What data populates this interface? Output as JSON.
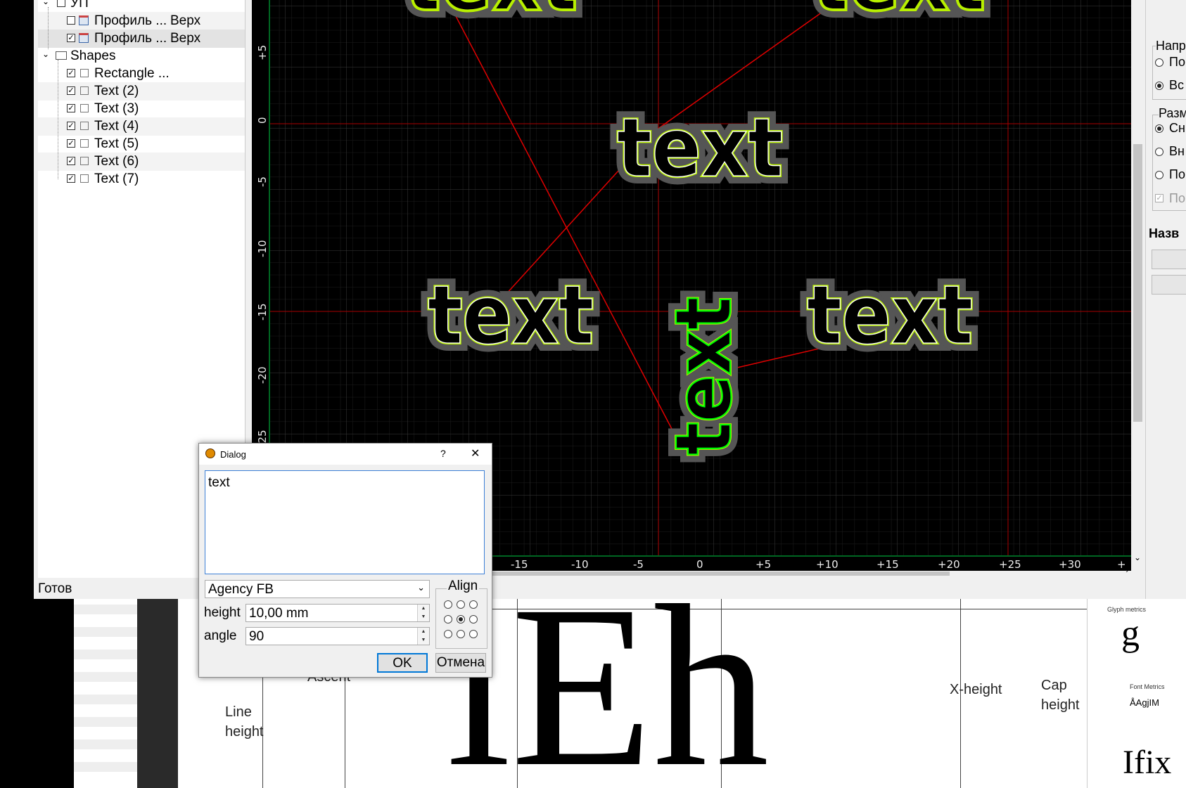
{
  "tree": {
    "items": [
      {
        "label": "УП",
        "checked": false,
        "level": 1
      },
      {
        "label": "Профиль ...",
        "side": "Верх",
        "checked": false,
        "level": 2
      },
      {
        "label": "Профиль ...",
        "side": "Верх",
        "checked": true,
        "level": 2,
        "selected": true
      },
      {
        "label": "Shapes",
        "level": 1
      },
      {
        "label": "Rectangle ...",
        "checked": true,
        "level": 2
      },
      {
        "label": "Text (2)",
        "checked": true,
        "level": 2
      },
      {
        "label": "Text (3)",
        "checked": true,
        "level": 2
      },
      {
        "label": "Text (4)",
        "checked": true,
        "level": 2
      },
      {
        "label": "Text (5)",
        "checked": true,
        "level": 2
      },
      {
        "label": "Text (6)",
        "checked": true,
        "level": 2
      },
      {
        "label": "Text (7)",
        "checked": true,
        "level": 2
      }
    ]
  },
  "status": "Готов",
  "canvas": {
    "shape_text": "text",
    "vruler_ticks": [
      "+5",
      "0",
      "-5",
      "-10",
      "-15",
      "-20",
      "-25"
    ],
    "hruler_ticks": [
      "-15",
      "-10",
      "-5",
      "0",
      "+5",
      "+10",
      "+15",
      "+20",
      "+25",
      "+30",
      "+"
    ]
  },
  "right_panel": {
    "group1_title": "Напр",
    "group1_options": [
      {
        "label": "По",
        "on": false
      },
      {
        "label": "Вс",
        "on": true
      }
    ],
    "group2_title": "Разм",
    "group2_options": [
      {
        "label": "Сн",
        "on": true
      },
      {
        "label": "Вн",
        "on": false
      },
      {
        "label": "По",
        "on": false
      }
    ],
    "group2_check": "По",
    "name_label": "Назв"
  },
  "dialog": {
    "title": "Dialog",
    "help": "?",
    "close": "✕",
    "text_value": "text",
    "font": "Agency FB",
    "height_label": "height",
    "height_value": "10,00 mm",
    "angle_label": "angle",
    "angle_value": "90",
    "align_label": "Align",
    "ok": "OK",
    "cancel": "Отмена"
  },
  "background_doc": {
    "labels": {
      "ascent": "Ascent",
      "line_height_1": "Line",
      "line_height_2": "height",
      "x_height": "X-height",
      "cap_1": "Cap",
      "cap_2": "height",
      "glyph_metrics": "Glyph metrics",
      "font_metrics": "Font Metrics",
      "sample": "ÅAgjIM",
      "big_glyphs": "lEh",
      "bottom_glyphs": "Ifix"
    }
  },
  "colors": {
    "grid": "#1c1c1c",
    "grid_major": "#3a3a3a",
    "axis_red": "#c00000",
    "offset_green": "#b8f000",
    "selected_green": "#00ff00",
    "halo": "#555555"
  }
}
